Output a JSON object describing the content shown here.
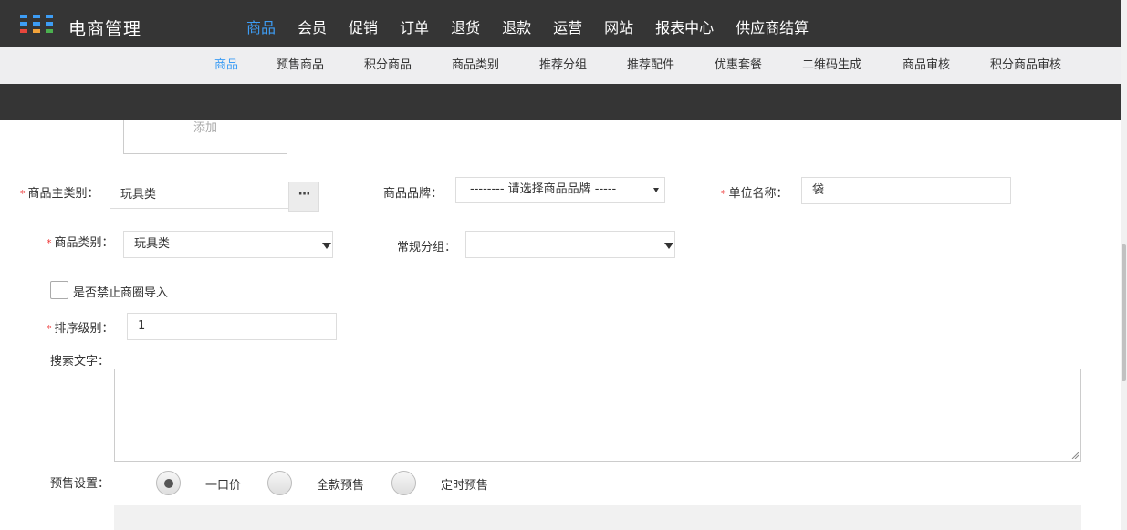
{
  "header": {
    "app_title": "电商管理",
    "logo_icon": "grid-logo-icon",
    "logo_colors": [
      "#3d9df5",
      "#3d9df5",
      "#3d9df5",
      "#3d9df5",
      "#e8463c",
      "#f3a33a",
      "#4bb04f",
      "#3d9df5"
    ]
  },
  "main_nav": [
    {
      "label": "商品",
      "active": true
    },
    {
      "label": "会员"
    },
    {
      "label": "促销"
    },
    {
      "label": "订单"
    },
    {
      "label": "退货"
    },
    {
      "label": "退款"
    },
    {
      "label": "运营"
    },
    {
      "label": "网站"
    },
    {
      "label": "报表中心"
    },
    {
      "label": "供应商结算"
    }
  ],
  "sub_nav": [
    {
      "label": "商品",
      "active": true
    },
    {
      "label": "预售商品"
    },
    {
      "label": "积分商品"
    },
    {
      "label": "商品类别"
    },
    {
      "label": "推荐分组"
    },
    {
      "label": "推荐配件"
    },
    {
      "label": "优惠套餐"
    },
    {
      "label": "二维码生成"
    },
    {
      "label": "商品审核"
    },
    {
      "label": "积分商品审核"
    }
  ],
  "form": {
    "add_button": "添加",
    "main_category_label": "商品主类别：",
    "main_category_value": "玩具类",
    "more_button": "···",
    "brand_label": "商品品牌：",
    "brand_value": "-------- 请选择商品品牌 -----",
    "unit_label": "单位名称：",
    "unit_value": "袋",
    "category_label": "商品类别：",
    "category_value": "玩具类",
    "group_label": "常规分组：",
    "group_value": "",
    "forbid_import_label": "是否禁止商圈导入",
    "forbid_import_checked": false,
    "sort_label": "排序级别：",
    "sort_value": "1",
    "search_text_label": "搜索文字：",
    "search_text_value": "",
    "presale_label": "预售设置：",
    "presale_options": [
      {
        "label": "一口价",
        "selected": true
      },
      {
        "label": "全款预售",
        "selected": false
      },
      {
        "label": "定时预售",
        "selected": false
      }
    ]
  },
  "colors": {
    "header_bg": "#353535",
    "accent": "#3d9df5",
    "subnav_bg": "#eeeef0",
    "required": "#e33333"
  }
}
